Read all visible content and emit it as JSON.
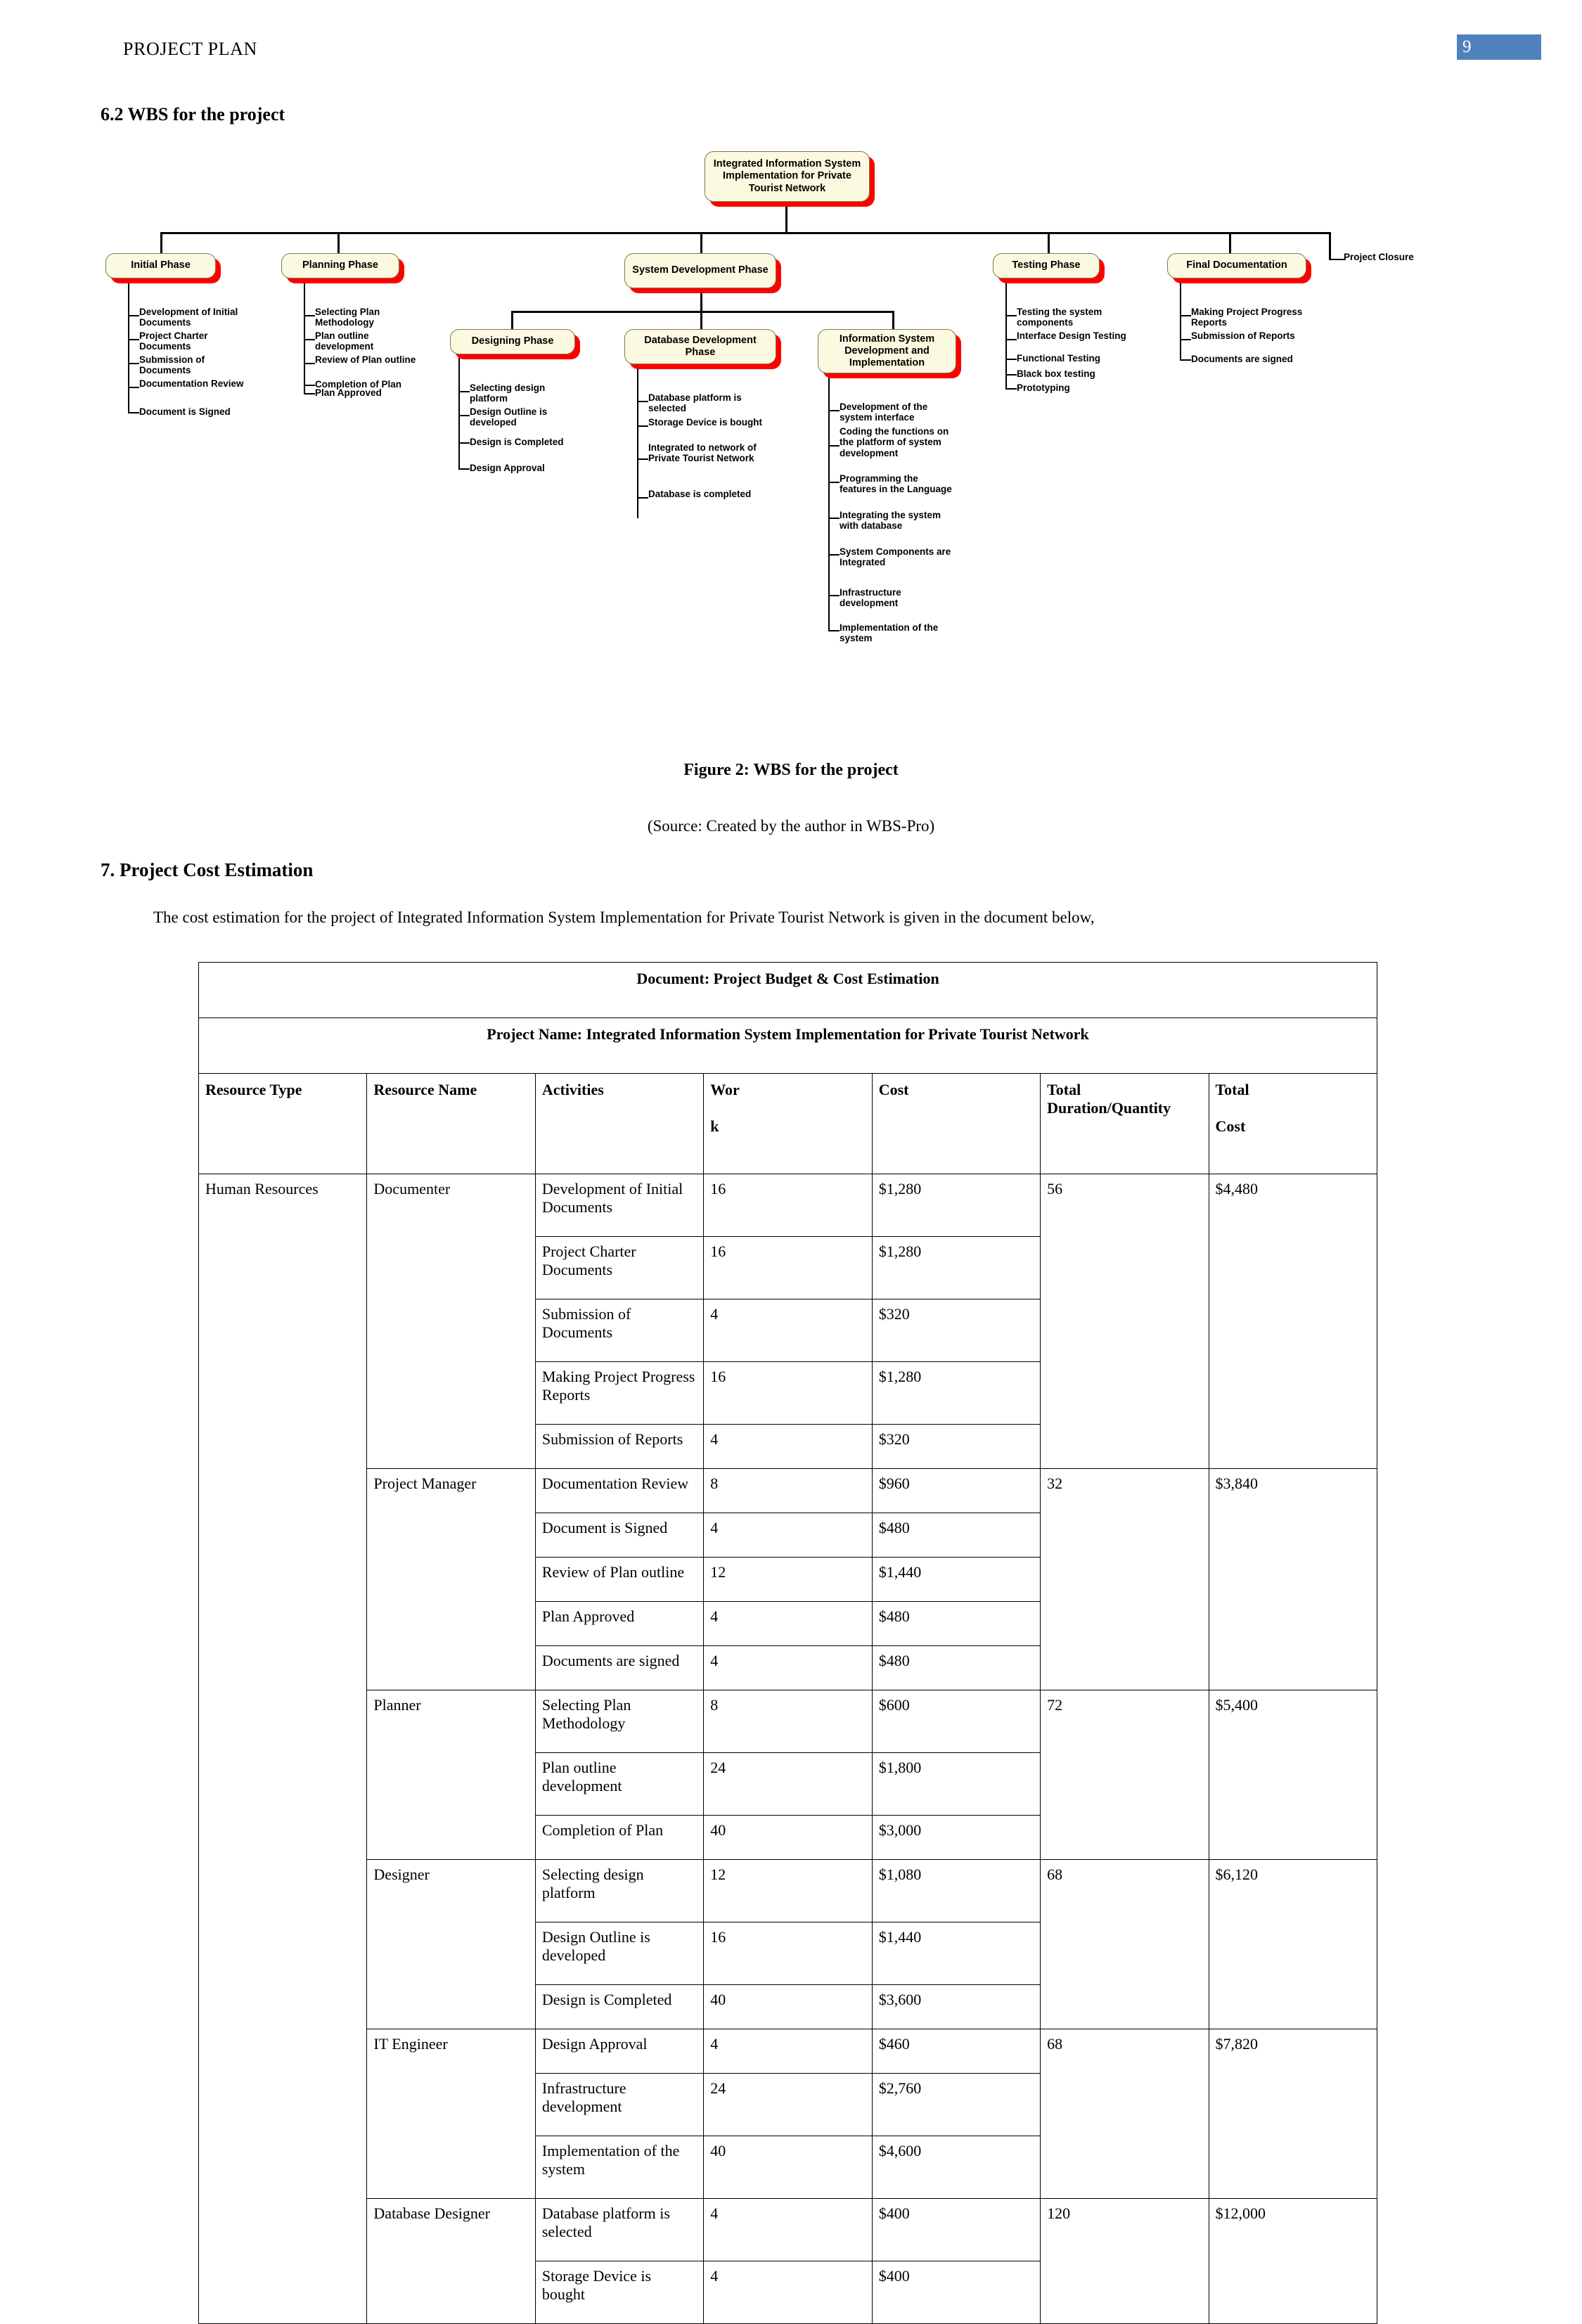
{
  "header": {
    "running_title": "PROJECT PLAN",
    "page_number": "9"
  },
  "sections": {
    "wbs_heading": "6.2 WBS for the project",
    "cost_heading": "7. Project Cost Estimation",
    "cost_intro": "The cost estimation for the project of Integrated Information System Implementation for Private Tourist Network is given in the document below,"
  },
  "figure": {
    "caption": "Figure 2: WBS for the project",
    "source": "(Source: Created by the author in WBS-Pro)"
  },
  "wbs": {
    "root": "Integrated Information System Implementation for Private Tourist Network",
    "node_fill": "#fbfae0",
    "node_shadow": "#fe0000",
    "phases": {
      "initial": {
        "title": "Initial Phase",
        "tasks": [
          "Development of Initial Documents",
          "Project Charter Documents",
          "Submission of Documents",
          "Documentation Review",
          "Document is Signed"
        ]
      },
      "planning": {
        "title": "Planning Phase",
        "tasks": [
          "Selecting Plan Methodology",
          "Plan outline development",
          "Review of Plan outline",
          "Completion of Plan",
          "Plan Approved"
        ]
      },
      "system_development": {
        "title": "System Development Phase",
        "sub": {
          "designing": {
            "title": "Designing Phase",
            "tasks": [
              "Selecting design platform",
              "Design Outline is developed",
              "Design is Completed",
              "Design Approval"
            ]
          },
          "database": {
            "title": "Database Development Phase",
            "tasks": [
              "Database platform is selected",
              "Storage Device is bought",
              "Integrated to network of Private Tourist Network",
              "Database is completed"
            ]
          },
          "information_system": {
            "title": "Information System Development and Implementation",
            "tasks": [
              "Development of the system interface",
              "Coding the functions on the platform of system development",
              "Programming the features in the Language",
              "Integrating the system with database",
              "System Components are Integrated",
              "Infrastructure development",
              "Implementation of the system"
            ]
          }
        }
      },
      "testing": {
        "title": "Testing Phase",
        "tasks": [
          "Testing the system components",
          "Interface Design Testing",
          "Functional Testing",
          "Black box testing",
          "Prototyping"
        ]
      },
      "final_documentation": {
        "title": "Final Documentation",
        "tasks": [
          "Making Project Progress Reports",
          "Submission of Reports",
          "Documents are signed"
        ]
      },
      "project_closure": {
        "title": "Project Closure"
      }
    }
  },
  "cost_table": {
    "banner1": "Document: Project Budget & Cost Estimation",
    "banner2": "Project Name: Integrated Information System Implementation for Private Tourist Network",
    "columns": {
      "resource_type": "Resource Type",
      "resource_name": "Resource Name",
      "activities": "Activities",
      "work_line1": "Wor",
      "work_line2": "k",
      "cost": "Cost",
      "total_duration": "Total Duration/Quantity",
      "total_line1": "Total",
      "total_line2": "Cost"
    },
    "resource_type": "Human Resources",
    "groups": [
      {
        "resource_name": "Documenter",
        "total_duration": "56",
        "total_cost": "$4,480",
        "rows": [
          {
            "activity": "Development of Initial Documents",
            "work": "16",
            "cost": "$1,280"
          },
          {
            "activity": "Project Charter Documents",
            "work": "16",
            "cost": "$1,280"
          },
          {
            "activity": "Submission of Documents",
            "work": "4",
            "cost": "$320"
          },
          {
            "activity": "Making Project Progress Reports",
            "work": "16",
            "cost": "$1,280"
          },
          {
            "activity": "Submission of Reports",
            "work": "4",
            "cost": "$320"
          }
        ]
      },
      {
        "resource_name": "Project Manager",
        "total_duration": "32",
        "total_cost": "$3,840",
        "rows": [
          {
            "activity": "Documentation Review",
            "work": "8",
            "cost": "$960"
          },
          {
            "activity": "Document is Signed",
            "work": "4",
            "cost": "$480"
          },
          {
            "activity": "Review of Plan outline",
            "work": "12",
            "cost": "$1,440"
          },
          {
            "activity": "Plan Approved",
            "work": "4",
            "cost": "$480"
          },
          {
            "activity": "Documents are signed",
            "work": "4",
            "cost": "$480"
          }
        ]
      },
      {
        "resource_name": "Planner",
        "total_duration": "72",
        "total_cost": "$5,400",
        "rows": [
          {
            "activity": "Selecting Plan Methodology",
            "work": "8",
            "cost": "$600"
          },
          {
            "activity": "Plan outline development",
            "work": "24",
            "cost": "$1,800"
          },
          {
            "activity": "Completion of Plan",
            "work": "40",
            "cost": "$3,000"
          }
        ]
      },
      {
        "resource_name": "Designer",
        "total_duration": "68",
        "total_cost": "$6,120",
        "rows": [
          {
            "activity": "Selecting design platform",
            "work": "12",
            "cost": "$1,080"
          },
          {
            "activity": "Design Outline is developed",
            "work": "16",
            "cost": "$1,440"
          },
          {
            "activity": "Design is Completed",
            "work": "40",
            "cost": "$3,600"
          }
        ]
      },
      {
        "resource_name": "IT Engineer",
        "total_duration": "68",
        "total_cost": "$7,820",
        "rows": [
          {
            "activity": "Design Approval",
            "work": "4",
            "cost": "$460"
          },
          {
            "activity": "Infrastructure development",
            "work": "24",
            "cost": "$2,760"
          },
          {
            "activity": "Implementation of the system",
            "work": "40",
            "cost": "$4,600"
          }
        ]
      },
      {
        "resource_name": "Database Designer",
        "total_duration": "120",
        "total_cost": "$12,000",
        "rows": [
          {
            "activity": "Database platform is selected",
            "work": "4",
            "cost": "$400"
          },
          {
            "activity": "Storage Device is bought",
            "work": "4",
            "cost": "$400"
          }
        ]
      }
    ]
  }
}
